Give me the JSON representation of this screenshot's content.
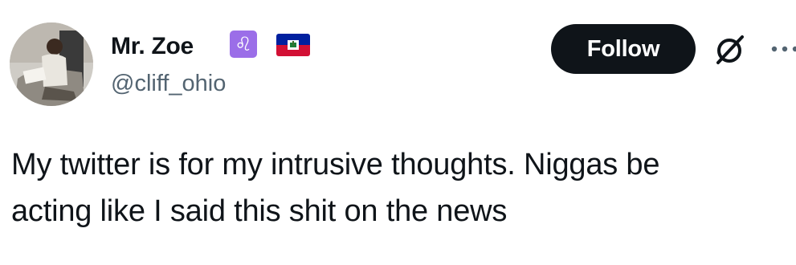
{
  "author": {
    "display_name": "Mr. Zoe",
    "handle": "@cliff_ohio",
    "badges": [
      {
        "icon": "leo-zodiac-icon",
        "glyph": "♌",
        "color": "#9b6ee8"
      },
      {
        "icon": "haiti-flag-icon"
      }
    ]
  },
  "actions": {
    "follow_label": "Follow",
    "grok_icon": "grok-icon",
    "more_icon": "more-icon"
  },
  "tweet": {
    "text_lines": [
      "My twitter is for my intrusive thoughts. Niggas be",
      "acting like I said this shit on the news"
    ]
  },
  "colors": {
    "text_primary": "#0f1419",
    "text_secondary": "#536471",
    "follow_button_bg": "#0f1419",
    "follow_button_text": "#ffffff"
  }
}
